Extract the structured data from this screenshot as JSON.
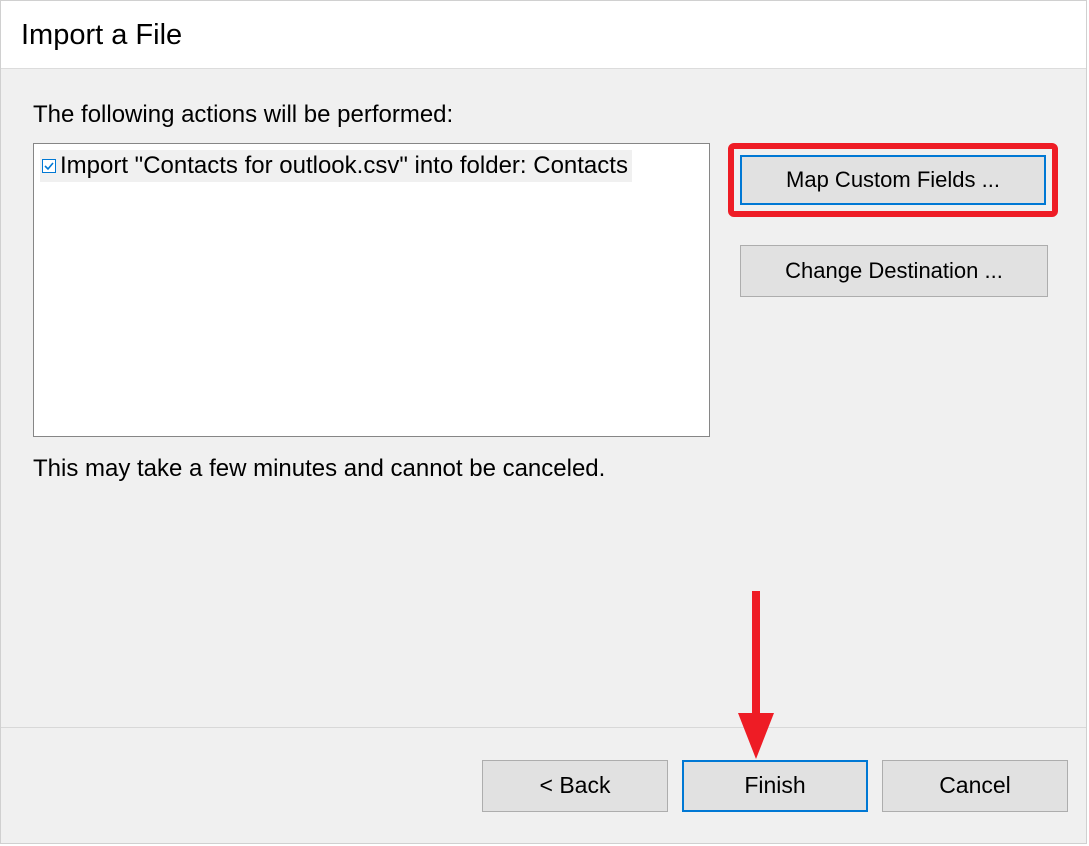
{
  "dialog": {
    "title": "Import a File",
    "actions_label": "The following actions will be performed:",
    "actions": [
      {
        "checked": true,
        "text": "Import \"Contacts for outlook.csv\" into folder: Contacts"
      }
    ],
    "side_buttons": {
      "map_custom_fields": "Map Custom Fields ...",
      "change_destination": "Change Destination ..."
    },
    "warning": "This may take a few minutes and cannot be canceled.",
    "footer": {
      "back": "< Back",
      "finish": "Finish",
      "cancel": "Cancel"
    }
  },
  "annotations": {
    "highlight_color": "#ee1c25",
    "arrow_color": "#ee1c25"
  }
}
